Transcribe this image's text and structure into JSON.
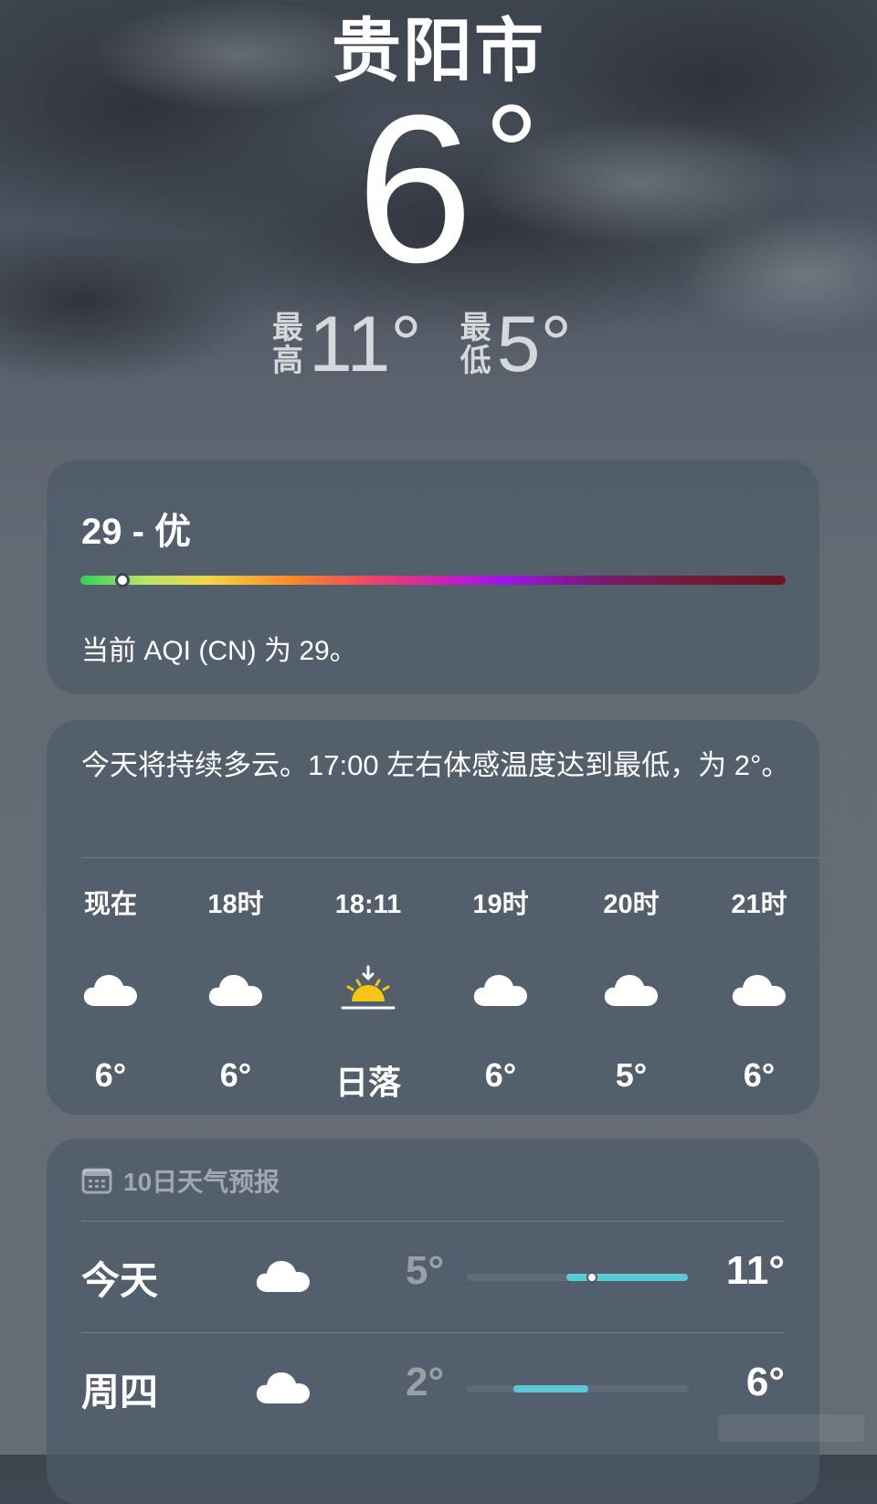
{
  "header": {
    "city": "贵阳市",
    "current_temp": "6",
    "degree_symbol": "°",
    "high_tag_1": "最",
    "high_tag_2": "高",
    "high_value": "11°",
    "low_tag_1": "最",
    "low_tag_2": "低",
    "low_value": "5°"
  },
  "aqi": {
    "headline": "29 - 优",
    "level_fraction": 0.06,
    "description": "当前 AQI (CN) 为 29。"
  },
  "hourly": {
    "summary": "今天将持续多云。17:00 左右体感温度达到最低，为 2°。",
    "items": [
      {
        "label": "现在",
        "icon": "cloud-icon",
        "value": "6°"
      },
      {
        "label": "18时",
        "icon": "cloud-icon",
        "value": "6°"
      },
      {
        "label": "18:11",
        "icon": "sunset-icon",
        "value": "日落"
      },
      {
        "label": "19时",
        "icon": "cloud-icon",
        "value": "6°"
      },
      {
        "label": "20时",
        "icon": "cloud-icon",
        "value": "5°"
      },
      {
        "label": "21时",
        "icon": "cloud-icon",
        "value": "6°"
      }
    ]
  },
  "daily": {
    "title": "10日天气预报",
    "icon": "calendar-icon",
    "rows": [
      {
        "day": "今天",
        "icon": "cloud-icon",
        "low": "5°",
        "high": "11°",
        "range_start": 0.45,
        "range_end": 1.0,
        "current": 0.56
      },
      {
        "day": "周四",
        "icon": "cloud-icon",
        "low": "2°",
        "high": "6°",
        "range_start": 0.21,
        "range_end": 0.55
      }
    ]
  },
  "colors": {
    "card_bg": "#4e5a6a",
    "range_bar": "#5cc8d6",
    "sun": "#f5c518"
  }
}
